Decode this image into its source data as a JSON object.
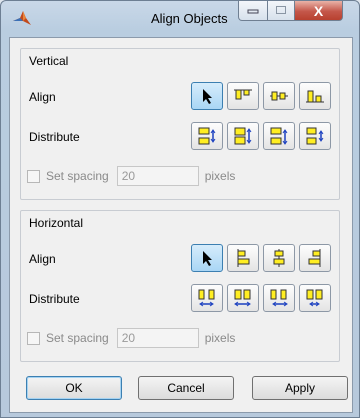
{
  "window": {
    "title": "Align Objects",
    "icons": {
      "app": "matlab-logo-icon",
      "minimize": "minimize-icon",
      "maximize": "maximize-icon",
      "close": "close-icon"
    },
    "close_glyph": "X"
  },
  "vertical": {
    "group_label": "Vertical",
    "align_label": "Align",
    "align_buttons": [
      "pointer-icon",
      "align-top-icon",
      "align-middle-icon",
      "align-bottom-icon"
    ],
    "distribute_label": "Distribute",
    "distribute_buttons": [
      "distribute-top-icon",
      "distribute-middle-icon",
      "distribute-bottom-icon",
      "distribute-spacing-icon"
    ],
    "set_spacing_label": "Set spacing",
    "spacing_value": "20",
    "units_label": "pixels"
  },
  "horizontal": {
    "group_label": "Horizontal",
    "align_label": "Align",
    "align_buttons": [
      "pointer-icon",
      "align-left-icon",
      "align-center-icon",
      "align-right-icon"
    ],
    "distribute_label": "Distribute",
    "distribute_buttons": [
      "distribute-left-icon",
      "distribute-center-icon",
      "distribute-right-icon",
      "distribute-h-spacing-icon"
    ],
    "set_spacing_label": "Set spacing",
    "spacing_value": "20",
    "units_label": "pixels"
  },
  "footer": {
    "ok_label": "OK",
    "cancel_label": "Cancel",
    "apply_label": "Apply"
  },
  "colors": {
    "selected_button": "#b7ddf7",
    "icon_fill": "#ffee22",
    "icon_stroke": "#333333",
    "arrow_blue": "#1a3fbf"
  }
}
